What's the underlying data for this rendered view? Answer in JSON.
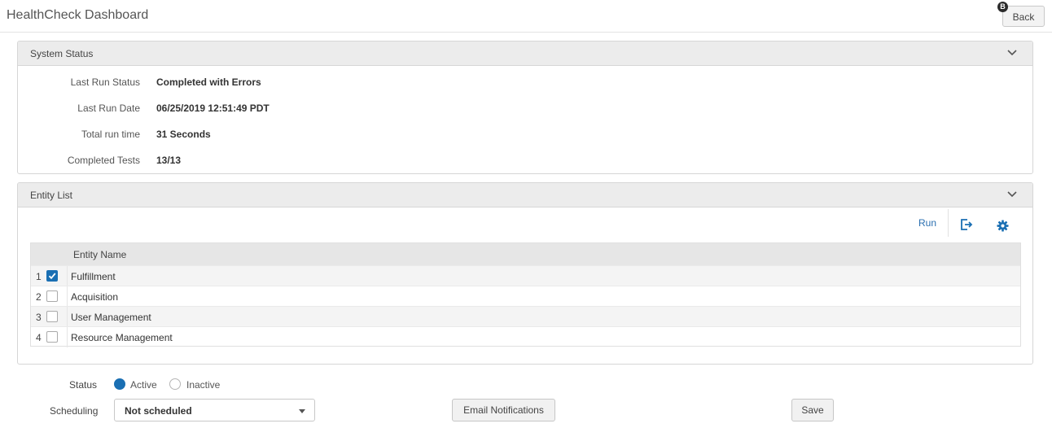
{
  "header": {
    "title": "HealthCheck Dashboard",
    "back_label": "Back",
    "back_shortcut": "B"
  },
  "system_status": {
    "title": "System Status",
    "rows": [
      {
        "label": "Last Run Status",
        "value": "Completed with Errors"
      },
      {
        "label": "Last Run Date",
        "value": "06/25/2019 12:51:49 PDT"
      },
      {
        "label": "Total run time",
        "value": "31 Seconds"
      },
      {
        "label": "Completed Tests",
        "value": "13/13"
      }
    ]
  },
  "entity_list": {
    "title": "Entity List",
    "run_label": "Run",
    "column_header": "Entity Name",
    "rows": [
      {
        "num": "1",
        "name": "Fulfillment",
        "checked": true
      },
      {
        "num": "2",
        "name": "Acquisition",
        "checked": false
      },
      {
        "num": "3",
        "name": "User Management",
        "checked": false
      },
      {
        "num": "4",
        "name": "Resource Management",
        "checked": false
      }
    ]
  },
  "settings": {
    "status_label": "Status",
    "status_options": [
      "Active",
      "Inactive"
    ],
    "status_selected": "Active",
    "scheduling_label": "Scheduling",
    "scheduling_value": "Not scheduled",
    "email_button": "Email Notifications",
    "save_button": "Save"
  },
  "colors": {
    "accent": "#1a6fb3",
    "link": "#2a6fb0",
    "header_bg": "#ececec"
  },
  "icons": [
    "chevron-down-icon",
    "export-icon",
    "gear-icon",
    "checkmark-icon"
  ]
}
